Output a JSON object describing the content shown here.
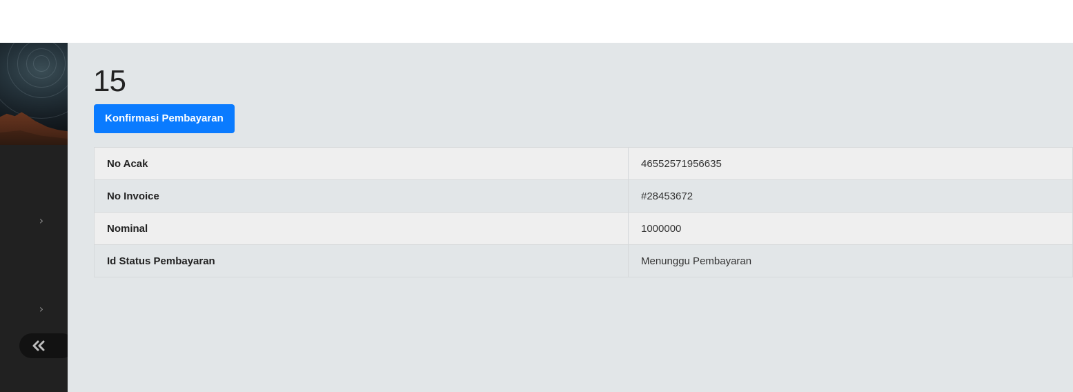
{
  "page": {
    "title": "15"
  },
  "actions": {
    "confirm_label": "Konfirmasi Pembayaran"
  },
  "sidebar": {
    "chevron_1": "›",
    "chevron_2": "›",
    "collapse_glyph": "«",
    "icons": [
      "chevron-right-icon",
      "chevron-right-icon",
      "double-chevron-left-icon"
    ]
  },
  "details": {
    "rows": [
      {
        "label": "No Acak",
        "value": "46552571956635"
      },
      {
        "label": "No Invoice",
        "value": "#28453672"
      },
      {
        "label": "Nominal",
        "value": "1000000"
      },
      {
        "label": "Id Status Pembayaran",
        "value": "Menunggu Pembayaran"
      }
    ]
  },
  "colors": {
    "primary_button": "#0a7bff",
    "sidebar_bg": "#212121",
    "main_bg": "#e2e6e8",
    "row_alt_bg": "#efefef"
  }
}
